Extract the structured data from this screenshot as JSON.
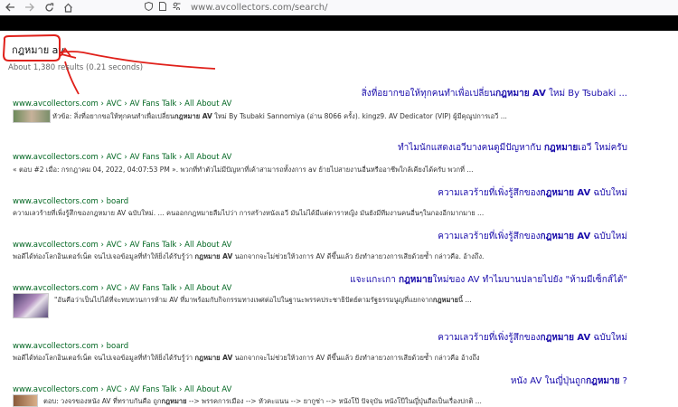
{
  "browser": {
    "url": "www.avcollectors.com/search/",
    "back_icon": "arrow-left-icon",
    "forward_icon": "arrow-right-icon",
    "reload_icon": "reload-icon",
    "home_icon": "home-icon"
  },
  "search": {
    "query": "กฎหมาย av",
    "stats": "About 1,380 results (0.21 seconds)"
  },
  "colors": {
    "title": "#1a0dab",
    "url": "#006621",
    "annotation": "#e0201a"
  },
  "results": [
    {
      "title_pre": "สิ่งที่อยากขอให้ทุกคนทำเพื่อเปลี่ยน",
      "title_bold": "กฎหมาย AV",
      "title_post": " ใหม่ By Tsubaki ...",
      "url": "www.avcollectors.com › AVC › AV Fans Talk › All About AV",
      "snippet_pre": "หัวข้อ: สิ่งที่อยากขอให้ทุกคนทำเพื่อเปลี่ยน",
      "snippet_bold": "กฎหมาย AV",
      "snippet_post": " ใหม่ By Tsubaki Sannomiya (อ่าน 8066 ครั้ง). kingz9. AV Dedicator (VIP) ผู้มีคุณูปการเอวี ..."
    },
    {
      "title_pre": "ทำไมนักแสดงเอวีบางคนดูมีปัญหากับ ",
      "title_bold": "กฎหมาย",
      "title_post": "เอวี ใหม่ครับ",
      "url": "www.avcollectors.com › AVC › AV Fans Talk › All About AV",
      "snippet_pre": "« ตอบ #2 เมื่อ: กรกฎาคม 04, 2022, 04:07:53 PM ». พวกที่ทำตัวไม่มีปัญหาที่เค้าสามารถทั้งงการ av ย้ายไปสายงานอื่นหรืออาชีพใกล้เคียงได้ครับ พวกที่ ...",
      "snippet_bold": "",
      "snippet_post": ""
    },
    {
      "title_pre": "ความเลวร้ายที่เพิ่งรู้สึกของ",
      "title_bold": "กฎหมาย AV",
      "title_post": " ฉบับใหม่",
      "url": "www.avcollectors.com › board",
      "snippet_pre": "ความเลวร้ายที่เพิ่งรู้สึกของกฎหมาย AV ฉบับใหม่. ... คนออกกฎหมายลืมไปว่า การสร้างหนังเอวี มันไม่ได้มีแต่ดาราหญิง มันยังมีทีมงานคนอื่นๆในกองอีกมากมาย ...",
      "snippet_bold": "",
      "snippet_post": ""
    },
    {
      "title_pre": "ความเลวร้ายที่เพิ่งรู้สึกของ",
      "title_bold": "กฎหมาย AV",
      "title_post": " ฉบับใหม่",
      "url": "www.avcollectors.com › AVC › AV Fans Talk › All About AV",
      "snippet_pre": "พอดีได้ท่องโลกอินเตอร์เน็ต จนไปเจอข้อมูลที่ทำให้ยิ่งได้รับรู้ว่า ",
      "snippet_bold": "กฎหมาย AV",
      "snippet_post": " นอกจากจะไม่ช่วยให้วงการ AV ดีขึ้นแล้ว ยังทำลายวงการเสียด้วยซ้ำ กล่าวคือ. อ้างถึง."
    },
    {
      "title_pre": "แจะแกะเกา ",
      "title_bold": "กฎหมาย",
      "title_post": "ใหม่ของ AV ทำไมบานปลายไปยัง \"ห้ามมีเซ็กส์ได้\"",
      "url": "www.avcollectors.com › AVC › AV Fans Talk › All About AV",
      "snippet_pre": "\"อันคือว่าเป็นไปได้ที่จะทบทวนการห้าม AV ที่มาพร้อมกับกิจกรรมทางเพศต่อไปในฐานะพรรคประชาธิปัตย์ตามรัฐธรรมนูญที่แยกจาก",
      "snippet_bold": "กฎหมาย",
      "snippet_post": "นี้ ..."
    },
    {
      "title_pre": "ความเลวร้ายที่เพิ่งรู้สึกของ",
      "title_bold": "กฎหมาย AV",
      "title_post": " ฉบับใหม่",
      "url": "www.avcollectors.com › board",
      "snippet_pre": "พอดีได้ท่องโลกอินเตอร์เน็ต จนไปเจอข้อมูลที่ทำให้ยิ่งได้รับรู้ว่า ",
      "snippet_bold": "กฎหมาย AV",
      "snippet_post": " นอกจากจะไม่ช่วยให้วงการ AV ดีขึ้นแล้ว ยังทำลายวงการเสียด้วยซ้ำ กล่าวคือ อ้างถึง"
    },
    {
      "title_pre": "หนัง AV ในญี่ปุ่นถูก",
      "title_bold": "กฎหมาย",
      "title_post": " ?",
      "url": "www.avcollectors.com › AVC › AV Fans Talk › All About AV",
      "snippet_pre": "ตอบ: วงจรของหนัง AV ที่ทราบกันคือ ถูก",
      "snippet_bold": "กฎหมาย",
      "snippet_post": " --> พรรคการเมือง --> หัวคะแนน --> ยากูซ่า --> หนังโป๊ ปัจจุบัน หนังโป๊ในญี่ปุ่นถือเป็นเรื่องปกติ ..."
    }
  ]
}
